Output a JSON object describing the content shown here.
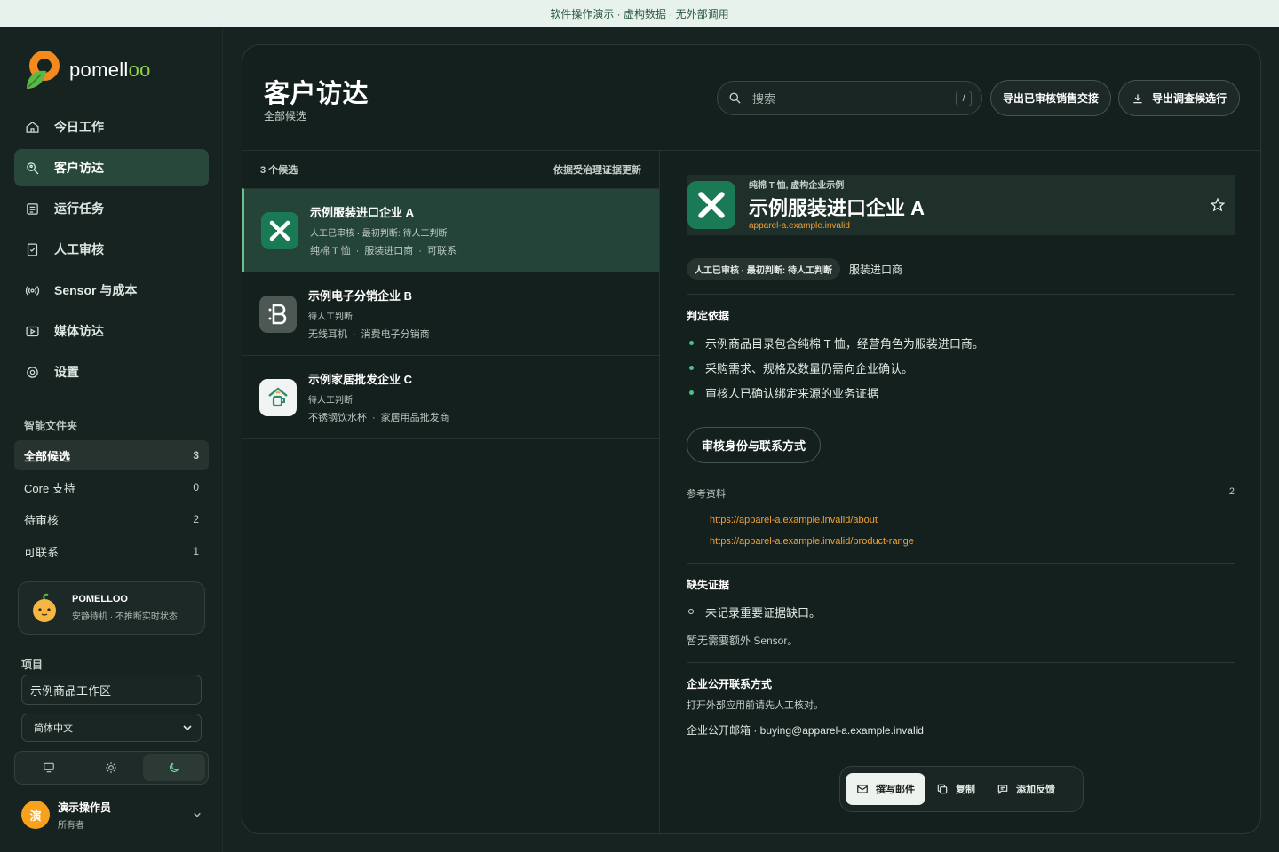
{
  "banner": "软件操作演示 · 虚构数据 · 无外部调用",
  "app": {
    "logo_text": "pomell",
    "logo_suffix": "oo"
  },
  "nav": [
    {
      "label": "今日工作",
      "icon": "home-icon",
      "active": false
    },
    {
      "label": "客户访达",
      "icon": "search-person-icon",
      "active": true
    },
    {
      "label": "运行任务",
      "icon": "list-icon",
      "active": false
    },
    {
      "label": "人工审核",
      "icon": "clipboard-check-icon",
      "active": false
    },
    {
      "label": "Sensor 与成本",
      "icon": "broadcast-icon",
      "active": false
    },
    {
      "label": "媒体访达",
      "icon": "media-icon",
      "active": false
    },
    {
      "label": "设置",
      "icon": "gear-icon",
      "active": false
    }
  ],
  "folders": {
    "title": "智能文件夹",
    "items": [
      {
        "label": "全部候选",
        "count": "3",
        "active": true
      },
      {
        "label": "Core 支持",
        "count": "0",
        "active": false
      },
      {
        "label": "待审核",
        "count": "2",
        "active": false
      },
      {
        "label": "可联系",
        "count": "1",
        "active": false
      }
    ]
  },
  "mascot": {
    "title": "POMELLOO",
    "status": "安静待机 · 不推断实时状态"
  },
  "project": {
    "label": "项目",
    "value": "示例商品工作区",
    "language": "简体中文"
  },
  "user": {
    "avatar_char": "演",
    "name": "演示操作员",
    "role": "所有者"
  },
  "header": {
    "title": "客户访达",
    "subtitle": "全部候选",
    "search_placeholder": "搜索",
    "search_shortcut": "/",
    "export_reviewed": "导出已审核销售交接",
    "export_candidates": "导出调查候选行"
  },
  "list": {
    "count_label": "3 个候选",
    "sort_label": "依据受治理证据更新",
    "items": [
      {
        "name": "示例服装进口企业 A",
        "status": "人工已审核 · 最初判断: 待人工判断",
        "tags": [
          "纯棉 T 恤",
          "服装进口商",
          "可联系"
        ],
        "icon": "excel-x-icon",
        "active": true
      },
      {
        "name": "示例电子分销企业 B",
        "status": "待人工判断",
        "tags": [
          "无线耳机",
          "消费电子分销商"
        ],
        "icon": "b-logo-icon",
        "active": false
      },
      {
        "name": "示例家居批发企业 C",
        "status": "待人工判断",
        "tags": [
          "不锈钢饮水杯",
          "家居用品批发商"
        ],
        "icon": "house-cup-icon",
        "active": false
      }
    ]
  },
  "detail": {
    "category": "纯棉 T 恤, 虚构企业示例",
    "name": "示例服装进口企业 A",
    "domain": "apparel-a.example.invalid",
    "badge": "人工已审核 · 最初判断: 待人工判断",
    "role": "服装进口商",
    "basis_title": "判定依据",
    "basis": [
      "示例商品目录包含纯棉 T 恤，经营角色为服装进口商。",
      "采购需求、规格及数量仍需向企业确认。",
      "审核人已确认绑定来源的业务证据"
    ],
    "review_button": "审核身份与联系方式",
    "refs_title": "参考资料",
    "refs_count": "2",
    "refs": [
      "https://apparel-a.example.invalid/about",
      "https://apparel-a.example.invalid/product-range"
    ],
    "missing_title": "缺失证据",
    "missing": [
      "未记录重要证据缺口。"
    ],
    "sensor_note": "暂无需要额外 Sensor。",
    "contact_title": "企业公开联系方式",
    "contact_note": "打开外部应用前请先人工核对。",
    "contact_email": "企业公开邮箱 · buying@apparel-a.example.invalid"
  },
  "actions": {
    "compose": "撰写邮件",
    "copy": "复制",
    "feedback": "添加反馈"
  },
  "colors": {
    "accent": "#4ec087",
    "link": "#f0a03a",
    "brand_orange": "#f6a21c",
    "active_bg": "#24443a"
  }
}
